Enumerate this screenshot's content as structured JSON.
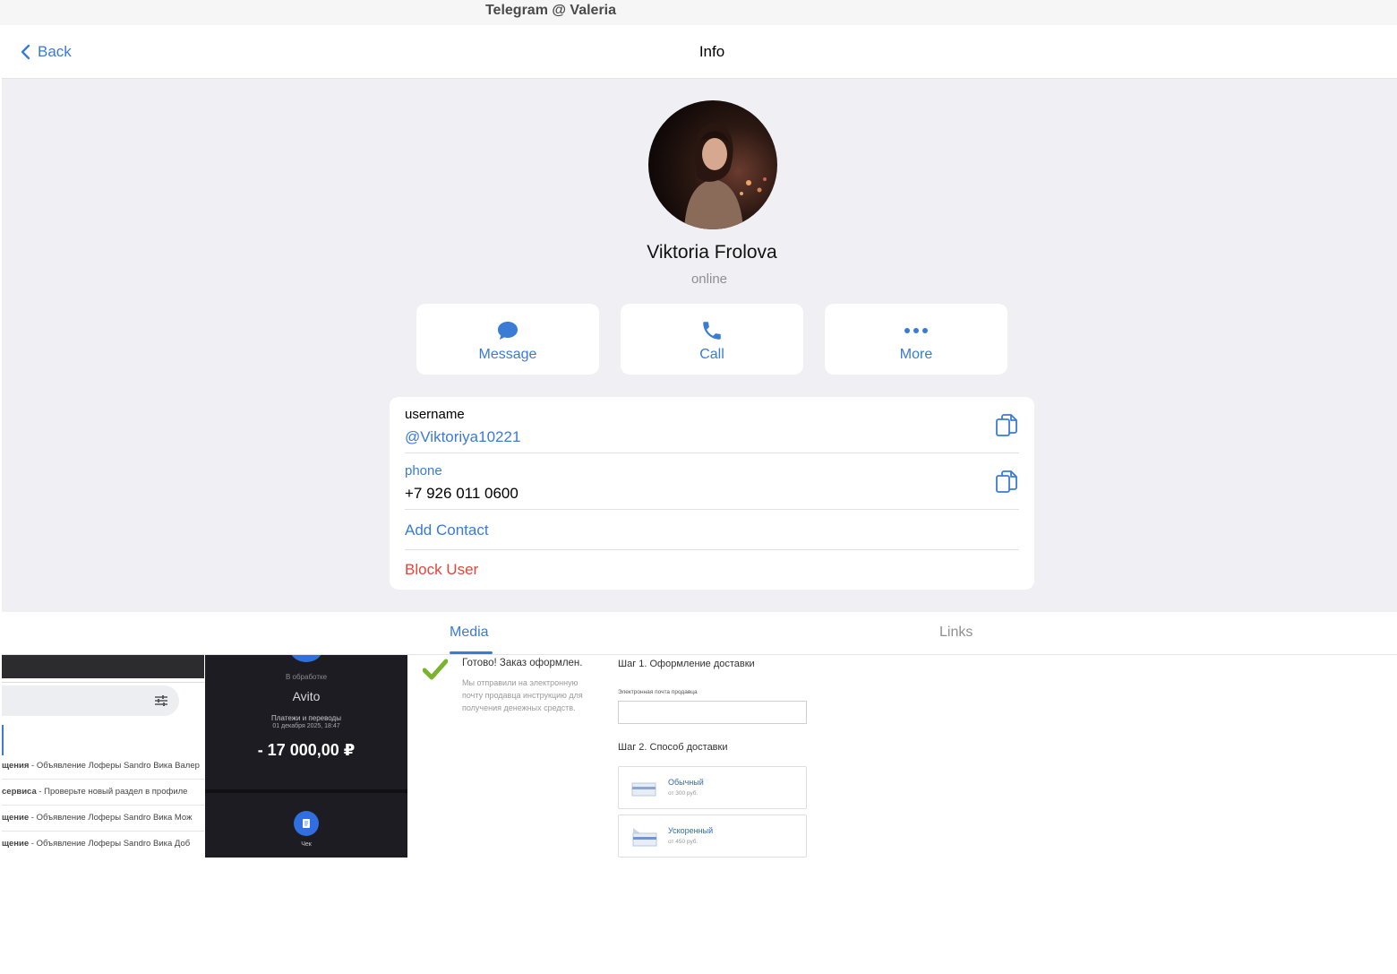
{
  "window": {
    "title": "Telegram @ Valeria"
  },
  "nav": {
    "back_label": "Back",
    "title": "Info"
  },
  "profile": {
    "name": "Viktoria Frolova",
    "status": "online"
  },
  "actions": [
    {
      "label": "Message",
      "icon": "chat-bubble-icon"
    },
    {
      "label": "Call",
      "icon": "phone-icon"
    },
    {
      "label": "More",
      "icon": "more-dots-icon"
    }
  ],
  "info": {
    "username_label": "username",
    "username_value": "@Viktoriya10221",
    "phone_label": "phone",
    "phone_value": "+7 926 011 0600",
    "add_contact": "Add Contact",
    "block_user": "Block User"
  },
  "tabs": [
    {
      "label": "Media",
      "active": true
    },
    {
      "label": "Links",
      "active": false
    }
  ],
  "media": {
    "item1": {
      "rows": [
        {
          "bold": "щения",
          "rest": " - Объявление Лоферы Sandro Вика Валер"
        },
        {
          "bold": "сервиса",
          "rest": " - Проверьте новый раздел в профиле"
        },
        {
          "bold": "щение",
          "rest": " - Объявление Лоферы Sandro Вика Мож"
        },
        {
          "bold": "щение",
          "rest": " - Объявление Лоферы Sandro Вика Доб"
        }
      ]
    },
    "item2": {
      "status": "В обработке",
      "merchant": "Avito",
      "category": "Платежи и переводы",
      "datetime": "01 декабря 2025, 18:47",
      "amount": "- 17 000,00 ₽",
      "receipt": "Чек"
    },
    "item3": {
      "done_title": "Готово! Заказ оформлен.",
      "done_text": "Мы отправили на электронную почту продавца инструкцию для получения денежных средств.",
      "step1": "Шаг 1. Оформление доставки",
      "email_label": "Электронная почта продавца",
      "step2": "Шаг 2. Способ доставки",
      "option1_title": "Обычный",
      "option1_price": "от 300 руб.",
      "option2_title": "Ускоренный",
      "option2_price": "от 450 руб."
    }
  },
  "colors": {
    "accent": "#3a7bd5",
    "danger": "#e0463b",
    "background": "#efeff4",
    "secondary_text": "#8e8e93"
  }
}
